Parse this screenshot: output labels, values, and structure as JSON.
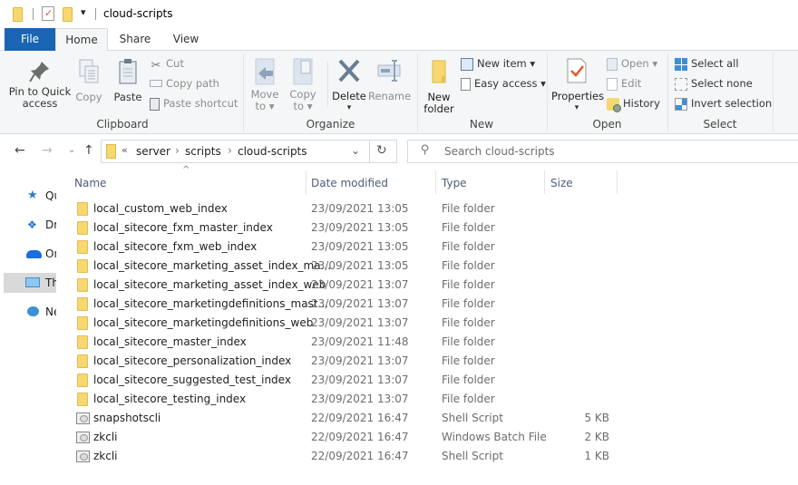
{
  "window": {
    "title": "cloud-scripts"
  },
  "quick_access_toolbar": {
    "dropdown_glyph": "▾"
  },
  "tabs": [
    {
      "label": "File",
      "active": false
    },
    {
      "label": "Home",
      "active": true
    },
    {
      "label": "Share",
      "active": false
    },
    {
      "label": "View",
      "active": false
    }
  ],
  "ribbon": {
    "clipboard": {
      "label": "Clipboard",
      "pin": "Pin to Quick access",
      "pin_line1": "Pin to Quick",
      "pin_line2": "access",
      "copy": "Copy",
      "paste": "Paste",
      "cut": "Cut",
      "copy_path": "Copy path",
      "paste_shortcut": "Paste shortcut"
    },
    "organize": {
      "label": "Organize",
      "move_to_1": "Move",
      "move_to_2": "to ▾",
      "copy_to_1": "Copy",
      "copy_to_2": "to ▾",
      "delete": "Delete",
      "delete_arrow": "▾",
      "rename": "Rename"
    },
    "new": {
      "label": "New",
      "new_folder_1": "New",
      "new_folder_2": "folder",
      "new_item": "New item ▾",
      "easy_access": "Easy access ▾"
    },
    "open": {
      "label": "Open",
      "properties": "Properties",
      "properties_arrow": "▾",
      "open": "Open ▾",
      "edit": "Edit",
      "history": "History"
    },
    "select": {
      "label": "Select",
      "select_all": "Select all",
      "select_none": "Select none",
      "invert_selection": "Invert selection"
    }
  },
  "navigation": {
    "back": "←",
    "forward": "→",
    "recent": "⌄",
    "up": "↑",
    "breadcrumb": {
      "overflow": "«",
      "separator": "›",
      "items": [
        "server",
        "scripts",
        "cloud-scripts"
      ]
    },
    "dropdown": "⌄",
    "refresh": "↻",
    "search_placeholder": "Search cloud-scripts"
  },
  "nav_pane": {
    "items": [
      {
        "label": "Quick access",
        "icon": "star-icon"
      },
      {
        "label": "Dropbox",
        "icon": "dropbox-icon"
      },
      {
        "label": "OneDrive",
        "icon": "cloud-icon"
      },
      {
        "label": "This PC",
        "icon": "computer-icon",
        "selected": true
      },
      {
        "label": "Network",
        "icon": "network-icon"
      }
    ]
  },
  "file_list": {
    "sort_indicator": "^",
    "columns": [
      "Name",
      "Date modified",
      "Type",
      "Size"
    ],
    "rows": [
      {
        "name": "local_custom_web_index",
        "date": "23/09/2021 13:05",
        "type": "File folder",
        "size": "",
        "kind": "folder"
      },
      {
        "name": "local_sitecore_fxm_master_index",
        "date": "23/09/2021 13:05",
        "type": "File folder",
        "size": "",
        "kind": "folder"
      },
      {
        "name": "local_sitecore_fxm_web_index",
        "date": "23/09/2021 13:05",
        "type": "File folder",
        "size": "",
        "kind": "folder"
      },
      {
        "name": "local_sitecore_marketing_asset_index_ma...",
        "date": "23/09/2021 13:05",
        "type": "File folder",
        "size": "",
        "kind": "folder"
      },
      {
        "name": "local_sitecore_marketing_asset_index_web",
        "date": "23/09/2021 13:07",
        "type": "File folder",
        "size": "",
        "kind": "folder"
      },
      {
        "name": "local_sitecore_marketingdefinitions_mast...",
        "date": "23/09/2021 13:07",
        "type": "File folder",
        "size": "",
        "kind": "folder"
      },
      {
        "name": "local_sitecore_marketingdefinitions_web",
        "date": "23/09/2021 13:07",
        "type": "File folder",
        "size": "",
        "kind": "folder"
      },
      {
        "name": "local_sitecore_master_index",
        "date": "23/09/2021 11:48",
        "type": "File folder",
        "size": "",
        "kind": "folder"
      },
      {
        "name": "local_sitecore_personalization_index",
        "date": "23/09/2021 13:07",
        "type": "File folder",
        "size": "",
        "kind": "folder"
      },
      {
        "name": "local_sitecore_suggested_test_index",
        "date": "23/09/2021 13:07",
        "type": "File folder",
        "size": "",
        "kind": "folder"
      },
      {
        "name": "local_sitecore_testing_index",
        "date": "23/09/2021 13:07",
        "type": "File folder",
        "size": "",
        "kind": "folder"
      },
      {
        "name": "snapshotscli",
        "date": "22/09/2021 16:47",
        "type": "Shell Script",
        "size": "5 KB",
        "kind": "script"
      },
      {
        "name": "zkcli",
        "date": "22/09/2021 16:47",
        "type": "Windows Batch File",
        "size": "2 KB",
        "kind": "script"
      },
      {
        "name": "zkcli",
        "date": "22/09/2021 16:47",
        "type": "Shell Script",
        "size": "1 KB",
        "kind": "script"
      }
    ]
  },
  "colors": {
    "file_tab": "#1a65b3",
    "folder": "#f7d870",
    "ribbon_bg": "#f5f6f7",
    "selected_nav": "#d9d9d9"
  }
}
